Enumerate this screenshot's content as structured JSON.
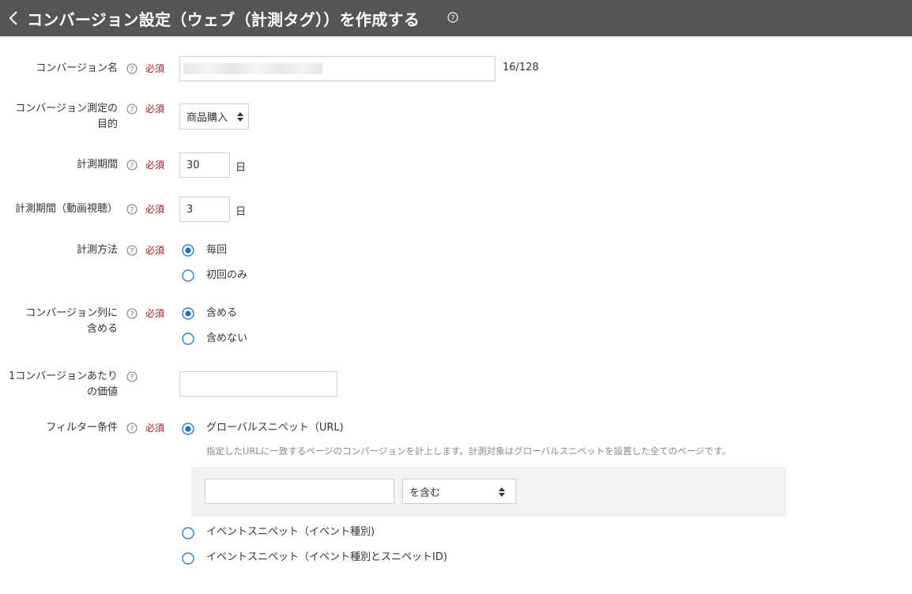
{
  "header": {
    "title": "コンバージョン設定（ウェブ（計測タグ））を作成する",
    "back_icon": "chevron-left-icon",
    "help_icon": "question-circle-icon"
  },
  "required_label": "必須",
  "fields": {
    "conversion_name": {
      "label": "コンバージョン名",
      "value": "",
      "counter": "16/128"
    },
    "purpose": {
      "label_line1": "コンバージョン測定の",
      "label_line2": "目的",
      "selected": "商品購入"
    },
    "period": {
      "label": "計測期間",
      "value": "30",
      "unit": "日"
    },
    "period_video": {
      "label": "計測期間（動画視聴）",
      "value": "3",
      "unit": "日"
    },
    "method": {
      "label": "計測方法",
      "options": [
        {
          "label": "毎回",
          "checked": true
        },
        {
          "label": "初回のみ",
          "checked": false
        }
      ]
    },
    "include": {
      "label_line1": "コンバージョン列に",
      "label_line2": "含める",
      "options": [
        {
          "label": "含める",
          "checked": true
        },
        {
          "label": "含めない",
          "checked": false
        }
      ]
    },
    "value_per": {
      "label_line1": "1コンバージョンあたり",
      "label_line2": "の価値",
      "value": ""
    },
    "filter": {
      "label": "フィルター条件",
      "options": [
        {
          "label": "グローバルスニペット（URL)",
          "checked": true
        },
        {
          "label": "イベントスニペット（イベント種別)",
          "checked": false
        },
        {
          "label": "イベントスニペット（イベント種別とスニペットID)",
          "checked": false
        }
      ],
      "description": "指定したURLに一致するページのコンバージョンを計上します。計測対象はグローバルスニペットを設置した全てのページです。",
      "url_value": "",
      "match_selected": "を含む"
    }
  },
  "colors": {
    "header_bg": "#555555",
    "required": "#a3161f",
    "radio": "#1a6fc4",
    "filter_box": "#f2f2f2"
  }
}
